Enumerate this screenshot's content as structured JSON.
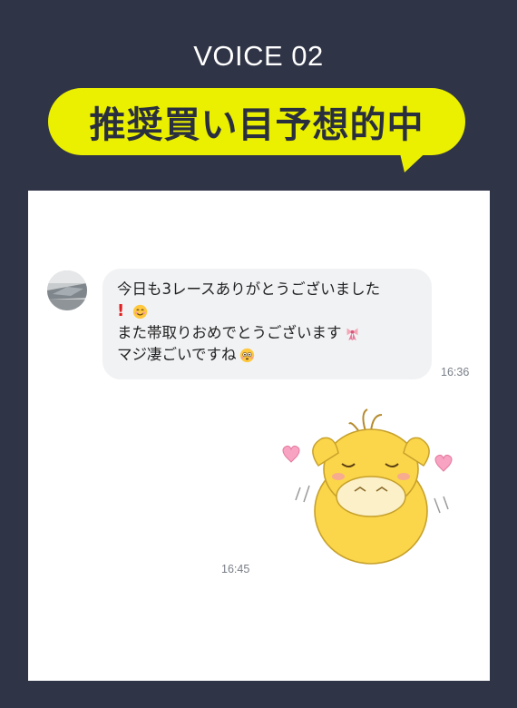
{
  "header": {
    "voice_label": "VOICE 02",
    "headline": "推奨買い目予想的中"
  },
  "chat": {
    "message": {
      "line1": "今日も3レースありがとうございました",
      "line2_emoji": "smiling-face-emoji",
      "line3": "また帯取りおめでとうございます",
      "line3_emoji": "ribbon-gift-emoji",
      "line4": "マジ凄ごいですね",
      "line4_emoji": "flushed-face-emoji",
      "time": "16:36"
    },
    "sticker": {
      "name": "yellow-duck-sticker",
      "time": "16:45"
    }
  },
  "colors": {
    "background": "#2f3447",
    "accent": "#ebf000",
    "bubble": "#f1f2f4"
  }
}
